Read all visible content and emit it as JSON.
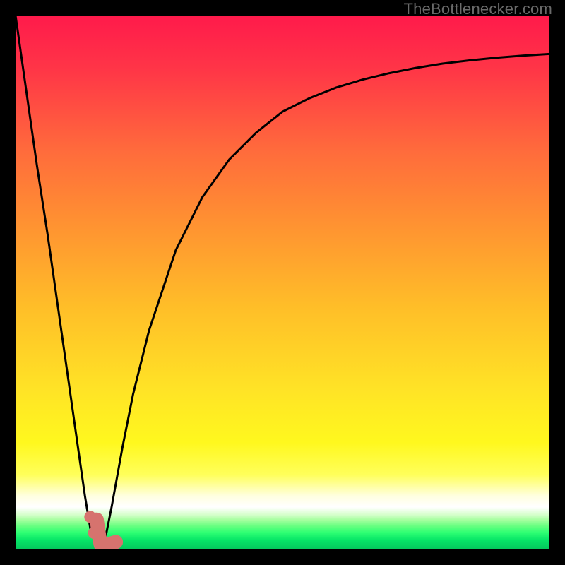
{
  "attribution": "TheBottlenecker.com",
  "colors": {
    "frame": "#000000",
    "curve": "#000000",
    "markers": "#d6736e",
    "attribution": "#6a6a6a"
  },
  "chart_data": {
    "type": "line",
    "title": "",
    "xlabel": "",
    "ylabel": "",
    "xlim": [
      0,
      100
    ],
    "ylim": [
      0,
      100
    ],
    "x": [
      0,
      2,
      4,
      6,
      8,
      10,
      12,
      13,
      14,
      15,
      16,
      17,
      18,
      20,
      22,
      25,
      30,
      35,
      40,
      45,
      50,
      55,
      60,
      65,
      70,
      75,
      80,
      85,
      90,
      95,
      100
    ],
    "series": [
      {
        "name": "bottleneck-curve",
        "values": [
          100,
          86,
          72,
          59,
          45,
          31,
          17,
          10,
          4,
          1,
          0,
          3,
          8,
          19,
          29,
          41,
          56,
          66,
          73,
          78,
          82,
          84.5,
          86.5,
          88,
          89.2,
          90.2,
          91,
          91.6,
          92.1,
          92.5,
          92.8
        ]
      }
    ],
    "gradient_stops": [
      {
        "pos": 0.0,
        "color": "#ff1a4b"
      },
      {
        "pos": 0.25,
        "color": "#ff6a3c"
      },
      {
        "pos": 0.55,
        "color": "#ffbf28"
      },
      {
        "pos": 0.8,
        "color": "#fff81e"
      },
      {
        "pos": 0.9,
        "color": "#ffffe0"
      },
      {
        "pos": 0.92,
        "color": "#ffffff"
      },
      {
        "pos": 0.96,
        "color": "#66ff80"
      },
      {
        "pos": 1.0,
        "color": "#04c75c"
      }
    ],
    "markers": {
      "dots_xy": [
        [
          14.0,
          6.1
        ],
        [
          14.7,
          3.1
        ]
      ],
      "hook": {
        "start_xy": [
          15.2,
          5.6
        ],
        "bottom_xy": [
          16.0,
          0.9
        ],
        "end_xy": [
          18.8,
          1.4
        ]
      }
    }
  }
}
